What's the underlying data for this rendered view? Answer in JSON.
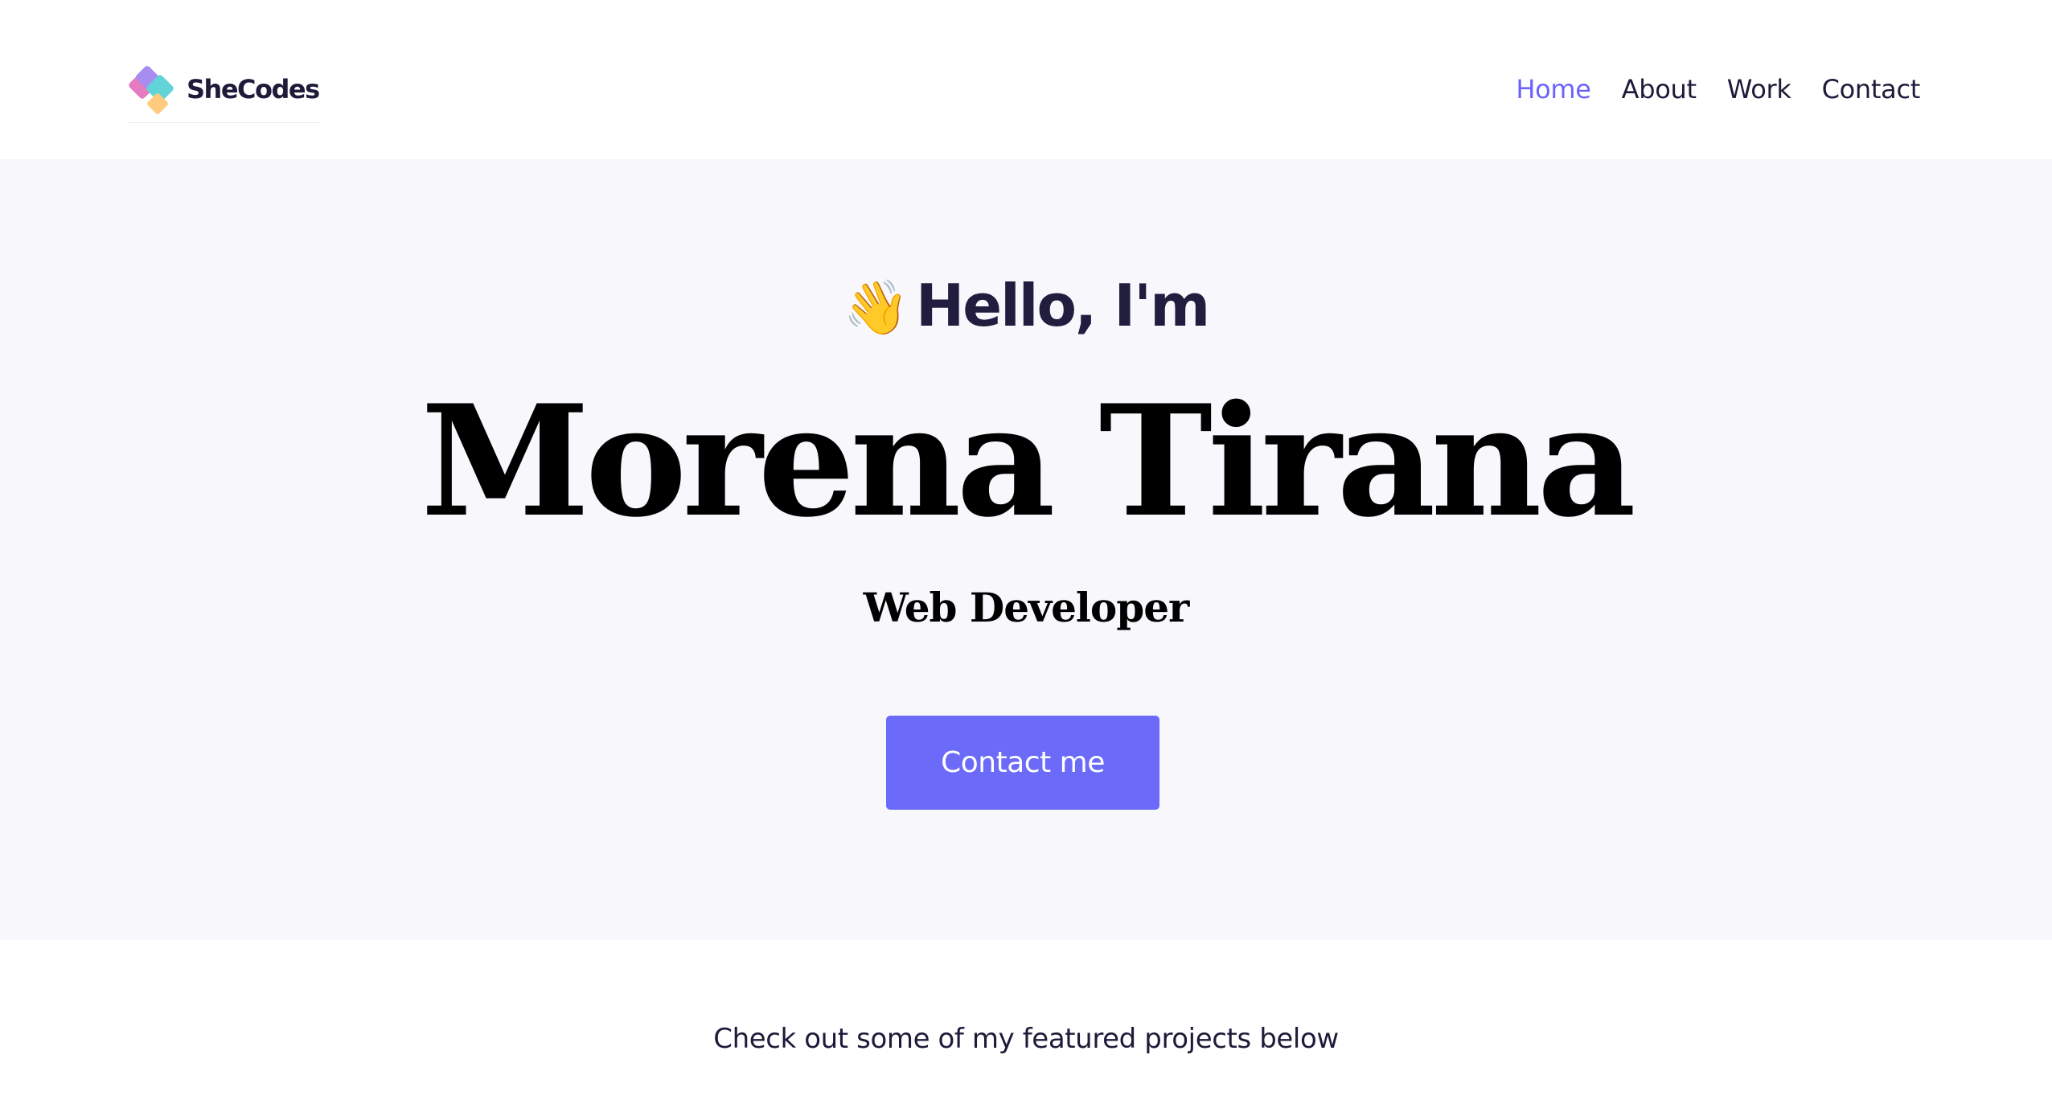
{
  "header": {
    "logo_text": "SheCodes",
    "nav": [
      {
        "label": "Home",
        "active": true
      },
      {
        "label": "About",
        "active": false
      },
      {
        "label": "Work",
        "active": false
      },
      {
        "label": "Contact",
        "active": false
      }
    ],
    "accent_color": "#6c63ff"
  },
  "hero": {
    "wave_emoji": "👋",
    "greeting": "Hello, I'm",
    "name": "Morena Tirana",
    "role": "Web Developer",
    "cta_label": "Contact me",
    "background": "#f7f7fc",
    "button_color": "#6c6af8"
  },
  "featured": {
    "text": "Check out some of my featured projects below"
  },
  "icons": {
    "home": "home-icon",
    "logo": "shecodes-logo-icon"
  }
}
